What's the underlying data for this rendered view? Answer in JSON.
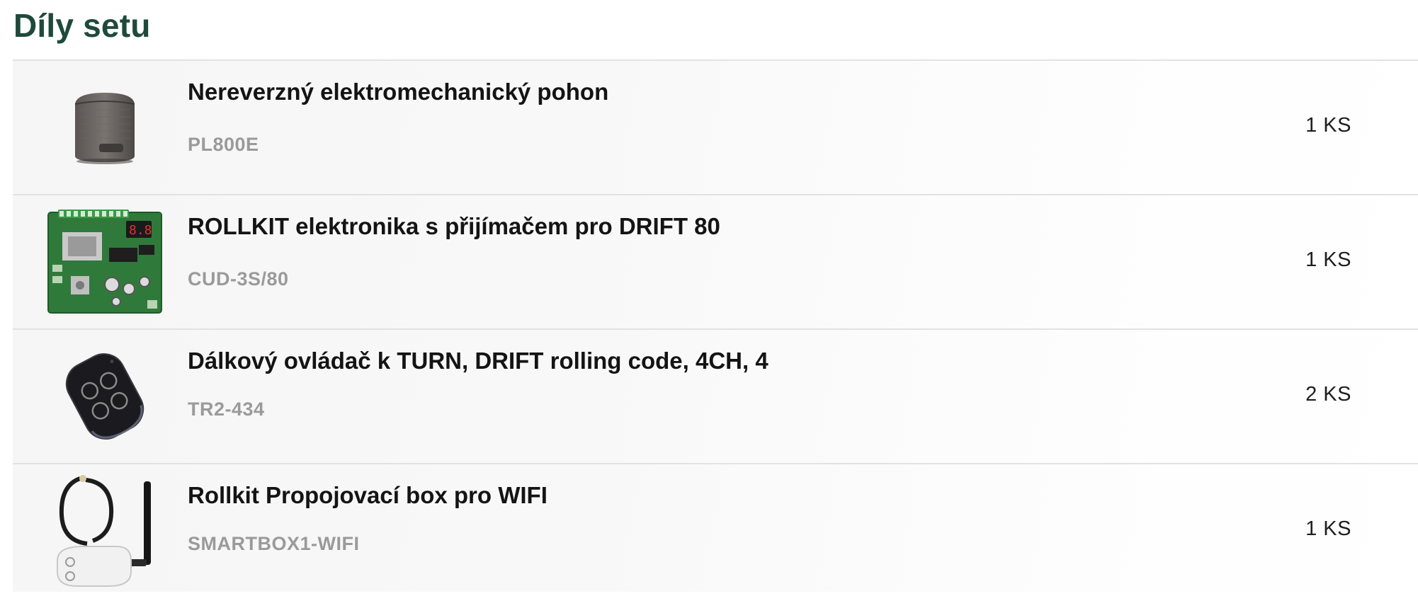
{
  "section": {
    "title": "Díly setu"
  },
  "parts": [
    {
      "name": "Nereverzný elektromechanický pohon",
      "code": "PL800E",
      "quantity": "1 KS",
      "icon": "motor-unit-image"
    },
    {
      "name": "ROLLKIT elektronika s přijímačem pro DRIFT 80",
      "code": "CUD-3S/80",
      "quantity": "1 KS",
      "icon": "circuit-board-image"
    },
    {
      "name": "Dálkový ovládač k TURN, DRIFT rolling code, 4CH, 4",
      "code": "TR2-434",
      "quantity": "2 KS",
      "icon": "remote-control-image"
    },
    {
      "name": "Rollkit Propojovací box pro WIFI",
      "code": "SMARTBOX1-WIFI",
      "quantity": "1 KS",
      "icon": "wifi-box-image"
    }
  ],
  "colors": {
    "title": "#1f4a3b",
    "name": "#141414",
    "code": "#9a9a9a",
    "divider": "#e2e2e2"
  }
}
